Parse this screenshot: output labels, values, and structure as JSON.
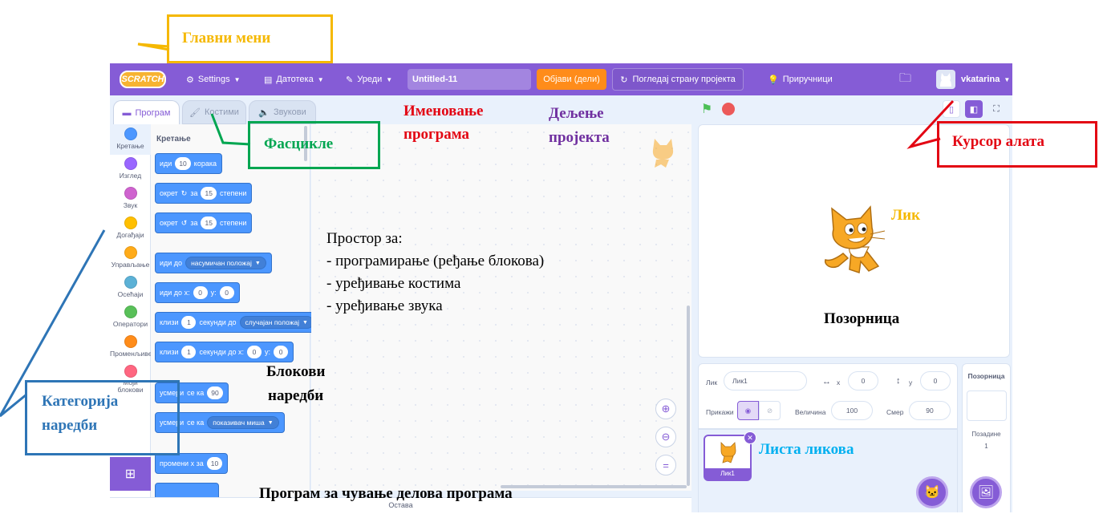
{
  "menubar": {
    "logo": "SCRATCH",
    "settings": "Settings",
    "file": "Датотека",
    "edit": "Уреди",
    "project_title": "Untitled-11",
    "share": "Објави (дели)",
    "see_project": "Погледај страну пројекта",
    "tutorials": "Приручници",
    "username": "vkatarina"
  },
  "tabs": [
    {
      "label": "Програм"
    },
    {
      "label": "Костими"
    },
    {
      "label": "Звукови"
    }
  ],
  "categories": [
    {
      "label": "Кретање",
      "color": "#4c97ff"
    },
    {
      "label": "Изглед",
      "color": "#9966ff"
    },
    {
      "label": "Звук",
      "color": "#cf63cf"
    },
    {
      "label": "Догађаји",
      "color": "#ffbf00"
    },
    {
      "label": "Управљање",
      "color": "#ffab19"
    },
    {
      "label": "Осећаји",
      "color": "#5cb1d6"
    },
    {
      "label": "Оператори",
      "color": "#59c059"
    },
    {
      "label": "Променљиве",
      "color": "#ff8c1a"
    },
    {
      "label": "Моји блокови",
      "color": "#ff6680"
    }
  ],
  "palette": {
    "title": "Кретање",
    "blocks": {
      "move": {
        "pre": "иди",
        "value": "10",
        "post": "корака"
      },
      "turn_right": {
        "pre": "окрет",
        "mid": "за",
        "value": "15",
        "post": "степени"
      },
      "turn_left": {
        "pre": "окрет",
        "mid": "за",
        "value": "15",
        "post": "степени"
      },
      "goto": {
        "pre": "иди до",
        "drop": "насумичан положај"
      },
      "goto_xy": {
        "pre": "иди до x:",
        "x": "0",
        "ylabel": "y:",
        "y": "0"
      },
      "glide": {
        "pre": "клизи",
        "value": "1",
        "mid": "секунди до",
        "drop": "случајан положај"
      },
      "glide_xy": {
        "pre": "клизи",
        "value": "1",
        "mid": "секунди до x:",
        "x": "0",
        "ylabel": "y:",
        "y": "0"
      },
      "point_dir": {
        "pre": "усмери",
        "mid": "се ка",
        "value": "90"
      },
      "point_towards": {
        "pre": "усмери",
        "mid": "се ка",
        "drop": "показивач миша"
      },
      "change_x": {
        "pre": "промени x за",
        "value": "10"
      }
    }
  },
  "backpack": {
    "label": "Остава"
  },
  "sprite_info": {
    "sprite_label": "Лик",
    "sprite_name": "Лик1",
    "x_label": "x",
    "x_value": "0",
    "y_label": "y",
    "y_value": "0",
    "show_label": "Прикажи",
    "size_label": "Величина",
    "size_value": "100",
    "direction_label": "Смер",
    "direction_value": "90"
  },
  "sprite_list": {
    "tile_name": "Лик1"
  },
  "stage_panel": {
    "title": "Позорница",
    "backdrops_label": "Позадине",
    "backdrops_count": "1"
  },
  "annotations": {
    "main_menu": "Главни мени",
    "folders": "Фасцикле",
    "naming_line1": "Именовање",
    "naming_line2": "програма",
    "sharing_line1": "Дељење",
    "sharing_line2": "пројекта",
    "tool_cursor": "Курсор алата",
    "sprite": "Лик",
    "stage": "Позорница",
    "space_title": "Простор за:",
    "space_item1": "- програмирање (ређање блокова)",
    "space_item2": "- уређивање костима",
    "space_item3": "- уређивање звука",
    "blocks_line1": "Блокови",
    "blocks_line2": "наредби",
    "category_line1": "Категорија",
    "category_line2": "наредби",
    "sprite_list": "Листа ликова",
    "backpack_note": "Програм за чување делова програма"
  },
  "colors": {
    "scratch_purple": "#855cd6",
    "motion_blue": "#4c97ff",
    "share_orange": "#ff8c1a",
    "ann_yellow": "#f5b800",
    "ann_green": "#00a651",
    "ann_red": "#e30613",
    "ann_blue": "#2e75b6",
    "ann_purple": "#7030a0",
    "ann_cyan": "#00b0f0"
  }
}
